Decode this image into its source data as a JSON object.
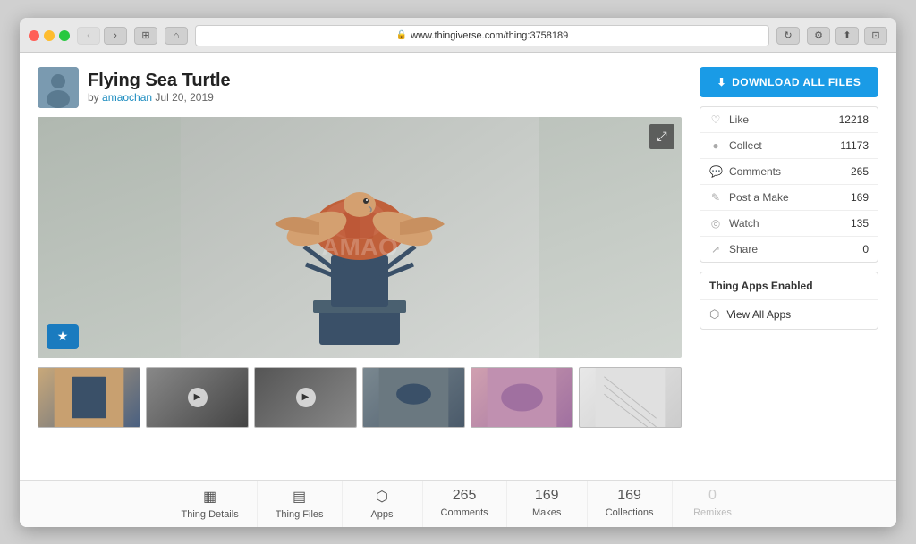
{
  "browser": {
    "url": "www.thingiverse.com/thing:3758189",
    "back_disabled": true,
    "forward_disabled": false
  },
  "page": {
    "title": "Flying Sea Turtle",
    "author": "amaochan",
    "date": "Jul 20, 2019",
    "byline_prefix": "by",
    "watermark": "AMAO"
  },
  "actions": {
    "download_btn": "DOWNLOAD ALL FILES",
    "expand_btn": "⤢"
  },
  "stats": [
    {
      "icon": "♡",
      "label": "Like",
      "count": "12218"
    },
    {
      "icon": "●",
      "label": "Collect",
      "count": "11173"
    },
    {
      "icon": "💬",
      "label": "Comments",
      "count": "265"
    },
    {
      "icon": "✎",
      "label": "Post a Make",
      "count": "169"
    },
    {
      "icon": "◎",
      "label": "Watch",
      "count": "135"
    },
    {
      "icon": "↗",
      "label": "Share",
      "count": "0"
    }
  ],
  "apps_section": {
    "header": "Thing Apps Enabled",
    "view_all_label": "View All Apps"
  },
  "tabs": [
    {
      "id": "thing-details",
      "label": "Thing Details",
      "icon": "▦",
      "count": null,
      "active": false
    },
    {
      "id": "thing-files",
      "label": "Thing Files",
      "icon": "▤",
      "count": null,
      "active": false
    },
    {
      "id": "apps",
      "label": "Apps",
      "icon": "⬡",
      "count": null,
      "active": false
    },
    {
      "id": "comments",
      "label": "Comments",
      "icon": null,
      "count": "265",
      "active": false
    },
    {
      "id": "makes",
      "label": "Makes",
      "icon": null,
      "count": "169",
      "active": false
    },
    {
      "id": "collections",
      "label": "Collections",
      "icon": null,
      "count": "169",
      "active": false
    },
    {
      "id": "remixes",
      "label": "Remixes",
      "icon": null,
      "count": "0",
      "active": false,
      "disabled": true
    }
  ]
}
